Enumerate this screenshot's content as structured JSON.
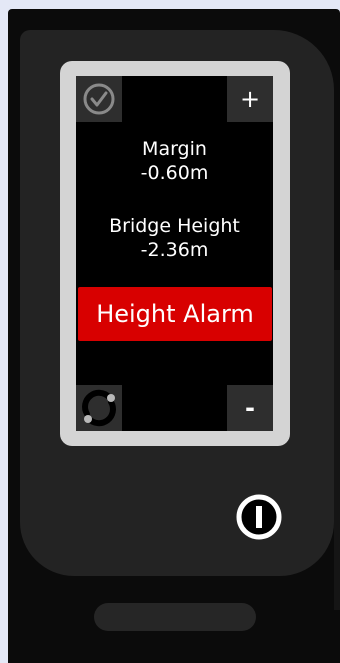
{
  "display": {
    "margin_label": "Margin",
    "margin_value": "-0.60m",
    "bridge_label": "Bridge Height",
    "bridge_value": "-2.36m",
    "alarm_text": "Height Alarm"
  },
  "buttons": {
    "plus_label": "+",
    "minus_label": "-",
    "check_icon": "check-circle-icon",
    "refresh_icon": "refresh-icon",
    "power_icon": "power-icon"
  },
  "colors": {
    "alarm": "#d80000",
    "frame": "#d4d4d4",
    "body": "#232323"
  }
}
